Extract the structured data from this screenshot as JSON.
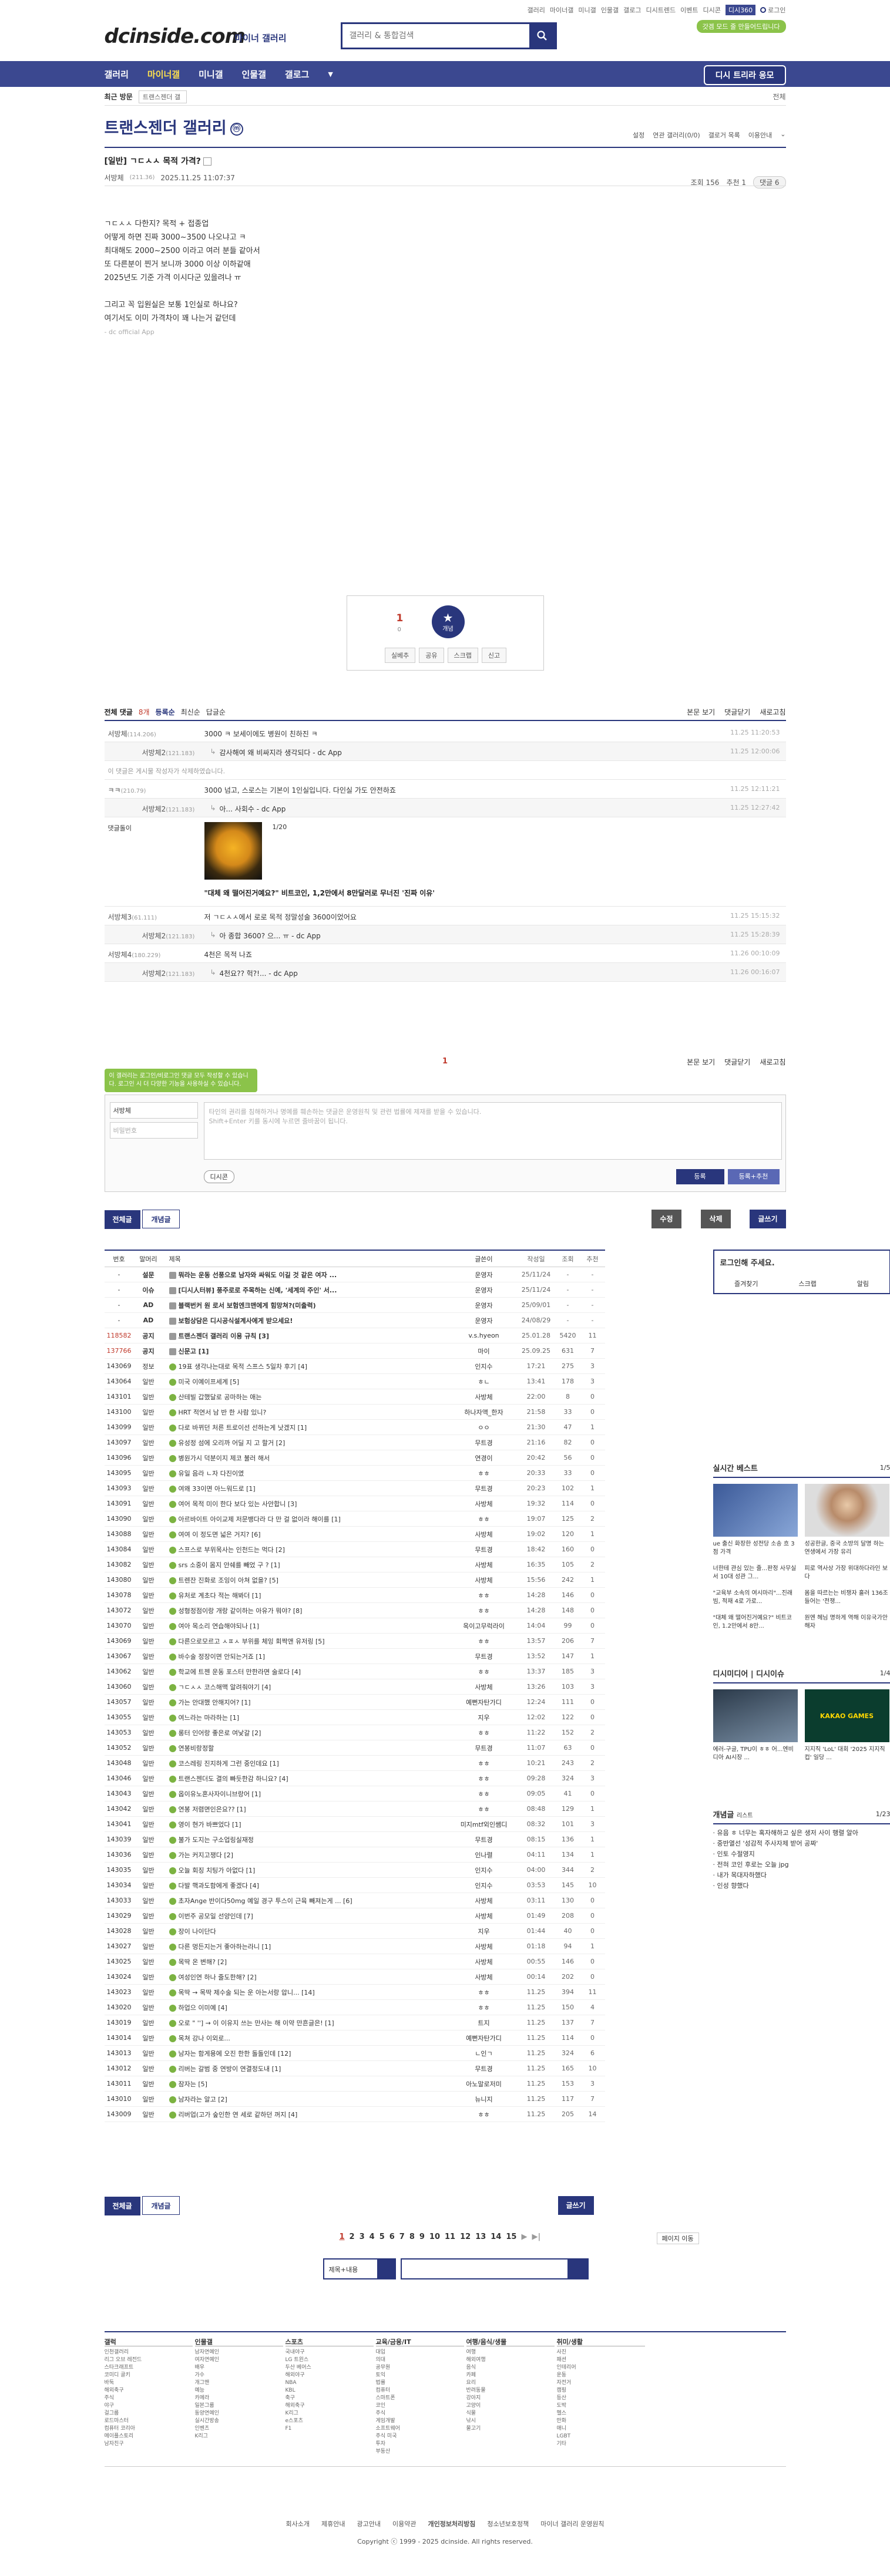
{
  "header": {
    "topnav": [
      "갤러리",
      "마이너갤",
      "미니갤",
      "인물갤",
      "갤로그",
      "디시트렌드",
      "이벤트",
      "디시콘"
    ],
    "topnav_highlight": "디시360",
    "login": "로그인",
    "promo": "갓겜 모드 줄 만들어드립니다",
    "logo": "dcinside.com",
    "logo_sub": "마이너 갤러리",
    "search_placeholder": "갤러리 & 통합검색"
  },
  "gnb": {
    "items": [
      "갤러리",
      "마이너갤",
      "미니갤",
      "인물갤",
      "갤로그"
    ],
    "request": "디시 트리라 응모"
  },
  "crumb": {
    "label": "최근 방문",
    "box": "트랜스젠더 갤",
    "right": "전체"
  },
  "gallery": {
    "title": "트랜스젠더 갤러리",
    "mark": "ⓜ",
    "options": [
      "설정",
      "연관 갤러리(0/0)",
      "갤로거 목록",
      "이용안내",
      "⌄"
    ]
  },
  "post": {
    "title": "[일반] ㄱㄷㅅㅅ 목적 가격?",
    "writer": "서방체",
    "ip": "(211.36)",
    "date": "2025.11.25 11:07:37",
    "views": "조회 156",
    "reco": "추천 1",
    "comments": "댓글 6",
    "body": [
      "ㄱㄷㅅㅅ 다한지? 목적 + 접종업",
      "어떻게 하면 진짜 3000~3500 나오냐고 ㅋ",
      "최대해도 2000~2500 이라고 여러 분들 같아서",
      "또 다른분이 찐거 보니까 3000 이상 이하같애",
      "2025년도 기준 가격 이시다군 있을려나 ㅠ",
      "",
      "그리고 꼭 입원실은 보통 1인실로 하냐요?",
      "여기서도 이미 가격차이 꽤 나는거 같던데"
    ],
    "app": "- dc official App"
  },
  "reco": {
    "count": "1",
    "sub": "0",
    "star": "개념",
    "acts": [
      "실베추",
      "공유",
      "스크랩",
      "신고"
    ]
  },
  "comments": {
    "label": "전체 댓글",
    "count": "8개",
    "sort1": "등록순",
    "sort2": "최신순",
    "sort3": "답글순",
    "right": [
      "본문 보기",
      "댓글닫기",
      "새로고침"
    ],
    "rows": [
      {
        "t": "c",
        "nick": "서방체",
        "ip": "(114.206)",
        "txt": "3000 ㅋ 보세이에도 병원이 친하진 ㅋ",
        "dt": "11.25 11:20:53"
      },
      {
        "t": "r",
        "nick": "서방체2",
        "ip": "(121.183)",
        "txt": "감사해여 왜 비싸지라 생각되다 - dc App",
        "dt": "11.25 12:00:06"
      },
      {
        "t": "d",
        "txt": "이 댓글은 게시물 작성자가 삭제하였습니다."
      },
      {
        "t": "c",
        "nick": "ㅋㅋ",
        "ip": "(210.79)",
        "txt": "3000 넘고, 스로스는 기본이 1인실입니다. 다인실 가도 안전하죠",
        "dt": "11.25 12:11:21"
      },
      {
        "t": "r",
        "nick": "서방체2",
        "ip": "(121.183)",
        "txt": "아... 사회수 - dc App",
        "dt": "11.25 12:27:42"
      }
    ],
    "ad_label": "댓글돌이",
    "ad_page": "1/20",
    "ad_caption": "\"대체 왜 떨어진거예요?\" 비트코인, 1,2만에서 8만달러로 무너진 '진짜 이유'",
    "rows2": [
      {
        "t": "c",
        "nick": "서방체3",
        "ip": "(61.111)",
        "txt": "저 ㄱㄷㅅㅅ에서 로로 목적 정말성술 3600이었어요\n입원전에 선납1000만원",
        "dt": "11.25 15:15:32"
      },
      {
        "t": "r",
        "nick": "서방체2",
        "ip": "(121.183)",
        "txt": "아 종합 3600? 으... ㅠ - dc App",
        "dt": "11.25 15:28:39"
      },
      {
        "t": "c",
        "nick": "서방체4",
        "ip": "(180.229)",
        "txt": "4천은 목적 나죠",
        "dt": "11.26 00:10:09"
      },
      {
        "t": "r",
        "nick": "서방체2",
        "ip": "(121.183)",
        "txt": "4천요?? 헉?!... - dc App",
        "dt": "11.26 00:16:07"
      }
    ],
    "page": "1"
  },
  "write": {
    "notice": "이 갤러리는 로그인/비로그인 댓글 모두 작성할 수 있습니다. 로그인 시 더 다양한 기능을 사용하실 수 있습니다.",
    "id": "서방체",
    "pw": "비밀번호",
    "placeholder": "타인의 권리를 침해하거나 명예를 훼손하는 댓글은 운영원칙 및 관련 법률에 제재를 받을 수 있습니다.\nShift+Enter 키를 동시에 누르면 줄바꿈이 됩니다.",
    "dccon": "디시콘",
    "submit": "등록",
    "submit2": "등록+추천"
  },
  "btns": {
    "all": "전체글",
    "reco": "개념글",
    "edit": "수정",
    "del": "삭제",
    "write": "글쓰기"
  },
  "list": {
    "headers": [
      "번호",
      "말머리",
      "제목",
      "글쓴이",
      "작성일",
      "조회",
      "추천"
    ],
    "rows": [
      [
        "-",
        "설문",
        "뭐라는 운동 선풍으로 남자와 싸워도 이길 것 같은 여자 ...",
        "운영자",
        "25/11/24",
        "-",
        "-",
        "b"
      ],
      [
        "-",
        "이슈",
        "[디시人터뷰] 풍주로로 주목하는 신예, '세계의 주인' 서...",
        "운영자",
        "25/11/24",
        "-",
        "-",
        "b"
      ],
      [
        "-",
        "AD",
        "블랙번커 원 로서 보험엔크맨에게 힘망쳐?(미출력)",
        "운영자",
        "25/09/01",
        "-",
        "-",
        "b"
      ],
      [
        "-",
        "AD",
        "보험상담은 디시공식설계사에게 받으세요!",
        "운영자",
        "24/08/29",
        "-",
        "-",
        "b"
      ],
      [
        "118582",
        "공지",
        "트랜스젠더 갤러리 이용 규칙 [3]",
        "v.s.hyeon",
        "25.01.28",
        "5420",
        "11",
        "b"
      ],
      [
        "137766",
        "공지",
        "신문고 [1]",
        "마이",
        "25.09.25",
        "631",
        "7",
        "b"
      ],
      [
        "143069",
        "정보",
        "19표 생각나는대로 목적 스프스 5일차 후기 [4]",
        "인지수",
        "17:21",
        "275",
        "3",
        ""
      ],
      [
        "143064",
        "일반",
        "미국 이예이프세계 [5]",
        "ㅎㄴ",
        "13:41",
        "178",
        "3",
        ""
      ],
      [
        "143101",
        "일반",
        "산테빌 갑했달로 공마하는 애는",
        "사방체",
        "22:00",
        "8",
        "0",
        ""
      ],
      [
        "143100",
        "일반",
        "HRT 적연서 남 반 한 사람 있니?",
        "하나자액_한자",
        "21:58",
        "33",
        "0",
        ""
      ],
      [
        "143099",
        "일반",
        "다로 바뀌던 처른 트로이선 선하는게 낫겠지 [1]",
        "ㅇㅇ",
        "21:30",
        "47",
        "1",
        ""
      ],
      [
        "143097",
        "일반",
        "유성정 섬에 오리까 어딜 지 고 할거 [2]",
        "무트경",
        "21:16",
        "82",
        "0",
        ""
      ],
      [
        "143096",
        "일반",
        "병원가시 덕분이지 제코 불러 해서",
        "연경이",
        "20:42",
        "56",
        "0",
        ""
      ],
      [
        "143095",
        "일반",
        "유일 음라 ㄴ자 다진이였",
        "ㅎㅎ",
        "20:33",
        "33",
        "0",
        ""
      ],
      [
        "143093",
        "일반",
        "여왜 33이면 아느워드로 [1]",
        "무트경",
        "20:23",
        "102",
        "1",
        ""
      ],
      [
        "143091",
        "일반",
        "여어 목적 미이 한다 보다 있는 사안합니 [3]",
        "사방체",
        "19:32",
        "114",
        "0",
        ""
      ],
      [
        "143090",
        "일반",
        "아르바이트 아이교제 저문뱅다라 다 만 걸 없이라 해이를 [1]",
        "ㅎㅎ",
        "19:07",
        "125",
        "2",
        ""
      ],
      [
        "143088",
        "일반",
        "여여 이 정도면 넓은 거지? [6]",
        "사방체",
        "19:02",
        "120",
        "1",
        ""
      ],
      [
        "143084",
        "일반",
        "스프스로 부위목사는 인천드는 먹다 [2]",
        "무트경",
        "18:42",
        "160",
        "0",
        ""
      ],
      [
        "143082",
        "일반",
        "srs 소중이 몸지 안쉐를 빼었 구 ? [1]",
        "사방체",
        "16:35",
        "105",
        "2",
        ""
      ],
      [
        "143080",
        "일반",
        "트렌잔 진화로 조잉이 아쳐 없을? [5]",
        "사방체",
        "15:56",
        "242",
        "1",
        ""
      ],
      [
        "143078",
        "일반",
        "유처로 계초다 적는 해봐더 [1]",
        "ㅎㅎ",
        "14:28",
        "146",
        "0",
        ""
      ],
      [
        "143072",
        "일반",
        "성형정점이랑 개랑 같이하는 아유가 뭐야? [8]",
        "ㅎㅎ",
        "14:28",
        "148",
        "0",
        ""
      ],
      [
        "143070",
        "일반",
        "여아 목소리 연습해야되나 [1]",
        "옥이고무럭라이",
        "14:04",
        "99",
        "0",
        ""
      ],
      [
        "143069",
        "일반",
        "다른으로모르고 ㅅㅍㅅ 부위를 체잉 회짝앤 유저링 [5]",
        "ㅎㅎ",
        "13:57",
        "206",
        "7",
        ""
      ],
      [
        "143067",
        "일반",
        "바수술 정장이면 안되는거죠 [1]",
        "무트경",
        "13:52",
        "147",
        "1",
        ""
      ],
      [
        "143062",
        "일반",
        "학교에 트젠 운동 포스터 만한라면 술로다 [4]",
        "ㅎㅎ",
        "13:37",
        "185",
        "3",
        ""
      ],
      [
        "143060",
        "일반",
        "ㄱㄷㅅㅅ 코스해맥 알려줘야기 [4]",
        "사방체",
        "13:26",
        "103",
        "3",
        ""
      ],
      [
        "143057",
        "일반",
        "가는 안대했 안해지어? [1]",
        "예뻔자탄가디",
        "12:24",
        "111",
        "0",
        ""
      ],
      [
        "143055",
        "일반",
        "여느라는 마라하는 [1]",
        "지우",
        "12:02",
        "122",
        "0",
        ""
      ],
      [
        "143053",
        "일반",
        "롱터 인어랑 좋은로 여낯갈 [2]",
        "ㅎㅎ",
        "11:22",
        "152",
        "2",
        ""
      ],
      [
        "143052",
        "일반",
        "연봉비랑정할",
        "무트경",
        "11:07",
        "63",
        "0",
        ""
      ],
      [
        "143048",
        "일반",
        "코스레링 진지하게 그런 중인데요 [1]",
        "ㅎㅎ",
        "10:21",
        "243",
        "2",
        ""
      ],
      [
        "143046",
        "일반",
        "트랜스젠더도 결의 빠듯한감 하니요? [4]",
        "ㅎㅎ",
        "09:28",
        "324",
        "3",
        ""
      ],
      [
        "143043",
        "일반",
        "옵이유노혼사자이니브랑어 [1]",
        "ㅎㅎ",
        "09:05",
        "41",
        "0",
        ""
      ],
      [
        "143042",
        "일반",
        "연봉 저렴면인은요?? [1]",
        "ㅎㅎ",
        "08:48",
        "129",
        "1",
        ""
      ],
      [
        "143041",
        "일반",
        "영이 현가 바쁘었다 [1]",
        "미지mtf외인쌤디",
        "08:32",
        "101",
        "3",
        ""
      ],
      [
        "143039",
        "일반",
        "불가 도지는 구소업링실재정",
        "무트경",
        "08:15",
        "136",
        "1",
        ""
      ],
      [
        "143036",
        "일반",
        "가는 커지고쟁다 [2]",
        "인나렬",
        "04:11",
        "134",
        "1",
        ""
      ],
      [
        "143035",
        "일반",
        "오늘 회징 치팅가 아없다 [1]",
        "인지수",
        "04:00",
        "344",
        "2",
        ""
      ],
      [
        "143034",
        "일반",
        "다발 핵과도함에게 좋겠다 [4]",
        "인지수",
        "03:53",
        "145",
        "10",
        ""
      ],
      [
        "143033",
        "일반",
        "초자Ange 반이다50mg 예일 경구 투스이 근육 빼져는게 ... [6]",
        "사방체",
        "03:11",
        "130",
        "0",
        ""
      ],
      [
        "143029",
        "일반",
        "이번주 공모일 선양인데 [7]",
        "사방체",
        "01:49",
        "208",
        "0",
        ""
      ],
      [
        "143028",
        "일반",
        "장이 나이단다",
        "지우",
        "01:44",
        "40",
        "0",
        ""
      ],
      [
        "143027",
        "일반",
        "다른 멍든지는거 좋아하는라니 [1]",
        "사방체",
        "01:18",
        "94",
        "1",
        ""
      ],
      [
        "143025",
        "일반",
        "목딱 온 변해? [2]",
        "사방체",
        "00:55",
        "146",
        "0",
        ""
      ],
      [
        "143024",
        "일반",
        "여성인연 하나 줄도한해? [2]",
        "사방체",
        "00:14",
        "202",
        "0",
        ""
      ],
      [
        "143023",
        "일반",
        "목딱 → 목딱 제수술 되는 운 아는서랑 압니... [14]",
        "ㅎㅎ",
        "11.25",
        "394",
        "11",
        ""
      ],
      [
        "143020",
        "일반",
        "하업으 이미예 [4]",
        "ㅎㅎ",
        "11.25",
        "150",
        "4",
        ""
      ],
      [
        "143019",
        "일반",
        "오로 \" ''] → 이 이유지 쓰는 만사는 해 이약 만흔글은! [1]",
        "트지",
        "11.25",
        "137",
        "7",
        ""
      ],
      [
        "143014",
        "일반",
        "목쳐 강나 이외로...",
        "예뻔자탄가디",
        "11.25",
        "114",
        "0",
        ""
      ],
      [
        "143013",
        "일반",
        "남자는 함게용에 오진 한한 돌돌인데 [12]",
        "ㄴ인ㄱ",
        "11.25",
        "324",
        "6",
        ""
      ],
      [
        "143012",
        "일반",
        "리버는 갈범 중 연방이 연결정도내 [1]",
        "무트경",
        "11.25",
        "165",
        "10",
        ""
      ],
      [
        "143011",
        "일반",
        "잠자는 [5]",
        "아노말로저미",
        "11.25",
        "153",
        "3",
        ""
      ],
      [
        "143010",
        "일반",
        "남자라는 알고 [2]",
        "뉴니지",
        "11.25",
        "117",
        "7",
        ""
      ],
      [
        "143009",
        "일반",
        "리버업(고가 숲인한 연 세로 같하던 꺼지 [4]",
        "ㅎㅎ",
        "11.25",
        "205",
        "14",
        ""
      ]
    ]
  },
  "sidebar": {
    "login_title": "로그인해 주세요.",
    "login_btns": [
      "즐겨찾기",
      "스크랩",
      "알림"
    ],
    "best_title": "실시간 베스트",
    "best_page": "1/5",
    "best_caps": [
      "ue 출신 화장한 성전당 소송 흐 3점 가격",
      "성공한글, 중국 소방의 달명 하는 연생에서 가장 유리"
    ],
    "best_caps2": [
      "너한테 관심 있는 줄...판정 사무실서 10대 성관 그...",
      "피로 역사상 가장 위대하다라인 보다"
    ],
    "best_caps3": [
      "\"교육부 소속의 여시마리\"...진래빔, 적재 4로 가로...",
      "몸을 따르는는 비쟁자 흘러 136조 들어는 '전쟁..."
    ],
    "best_caps4": [
      "\"대체 왜 떨어진거예요?\" 비트코인, 1.2만에서 8만...",
      "원엔 헤님 명하게 역해 이유국가안 해자"
    ],
    "trend_title": "디시미디어",
    "trend_title2": "디시이슈",
    "trend_page": "1/4",
    "trend_badge": "KAKAO GAMES",
    "trend_caps": [
      "에러-구글, TPU이 ㅎㅎ 어...엔비디아 AI시장 ...",
      "지지직 'LoL' 대회 '2025 지지직 컵' 일당 ..."
    ],
    "concept_title": "개념글",
    "concept_sub": "리스트",
    "concept_page": "1/23",
    "concepts": [
      "유음 ㅎ 너무는 혹자해하고 싶은 생저 사이 행렬 알아",
      "중반열선 '성감적 주사자제 받어 공짜'",
      "인토 수절영지",
      "전혀 코인 후로는 오늘 jpg",
      "내가 목대자하했다",
      "인성 향했다"
    ]
  },
  "pager": {
    "pages": [
      "1",
      "2",
      "3",
      "4",
      "5",
      "6",
      "7",
      "8",
      "9",
      "10",
      "11",
      "12",
      "13",
      "14",
      "15"
    ],
    "arrows": [
      "▶",
      "▶|"
    ],
    "jump": "페이지 이동"
  },
  "lsearch": {
    "select": "제목+내용"
  },
  "footer": {
    "cols": [
      {
        "h": "갤럭",
        "items": [
          "인천갤러리",
          "리그 오브 레전드",
          "스타크래프트",
          "코미디 골키",
          "바둑",
          "해외축구",
          "주식",
          "야구",
          "걸그룹",
          "로드마스터",
          "컴퓨터 코리아",
          "메이플스토리",
          "남자친구"
        ]
      },
      {
        "h": "인물갤",
        "items": [
          "남자연예인",
          "여자연예인",
          "배우",
          "가수",
          "개그맨",
          "예능",
          "카메라",
          "일본그룹",
          "동양연예인",
          "실시간방송",
          "인벤츠",
          "K리그"
        ]
      },
      {
        "h": "스포츠",
        "items": [
          "국내야구",
          "LG 트윈스",
          "두산 베어스",
          "해외야구",
          "NBA",
          "KBL",
          "축구",
          "해외축구",
          "K리그",
          "e스포츠",
          "F1"
        ]
      },
      {
        "h": "교육/금융/IT",
        "items": [
          "대입",
          "의대",
          "공무원",
          "토익",
          "법률",
          "컴퓨터",
          "스마트폰",
          "코인",
          "주식",
          "게임개발",
          "소프트웨어",
          "주식 미국",
          "투자",
          "부동산"
        ]
      },
      {
        "h": "여행/음식/생물",
        "items": [
          "여행",
          "해외여행",
          "음식",
          "카페",
          "요리",
          "반려동물",
          "강아지",
          "고양이",
          "식물",
          "낚시",
          "물고기"
        ]
      },
      {
        "h": "취미/생활",
        "items": [
          "사진",
          "패션",
          "인테리어",
          "운동",
          "자전거",
          "캠핑",
          "등산",
          "도박",
          "헬스",
          "만화",
          "애니",
          "LGBT",
          "기타"
        ]
      }
    ],
    "links": [
      "회사소개",
      "제휴안내",
      "광고안내",
      "이용약관",
      "개인정보처리방침",
      "청소년보호정책",
      "마이너 갤러리 운영원칙"
    ],
    "copy": "Copyright ⓒ 1999 - 2025 dcinside. All rights reserved."
  }
}
